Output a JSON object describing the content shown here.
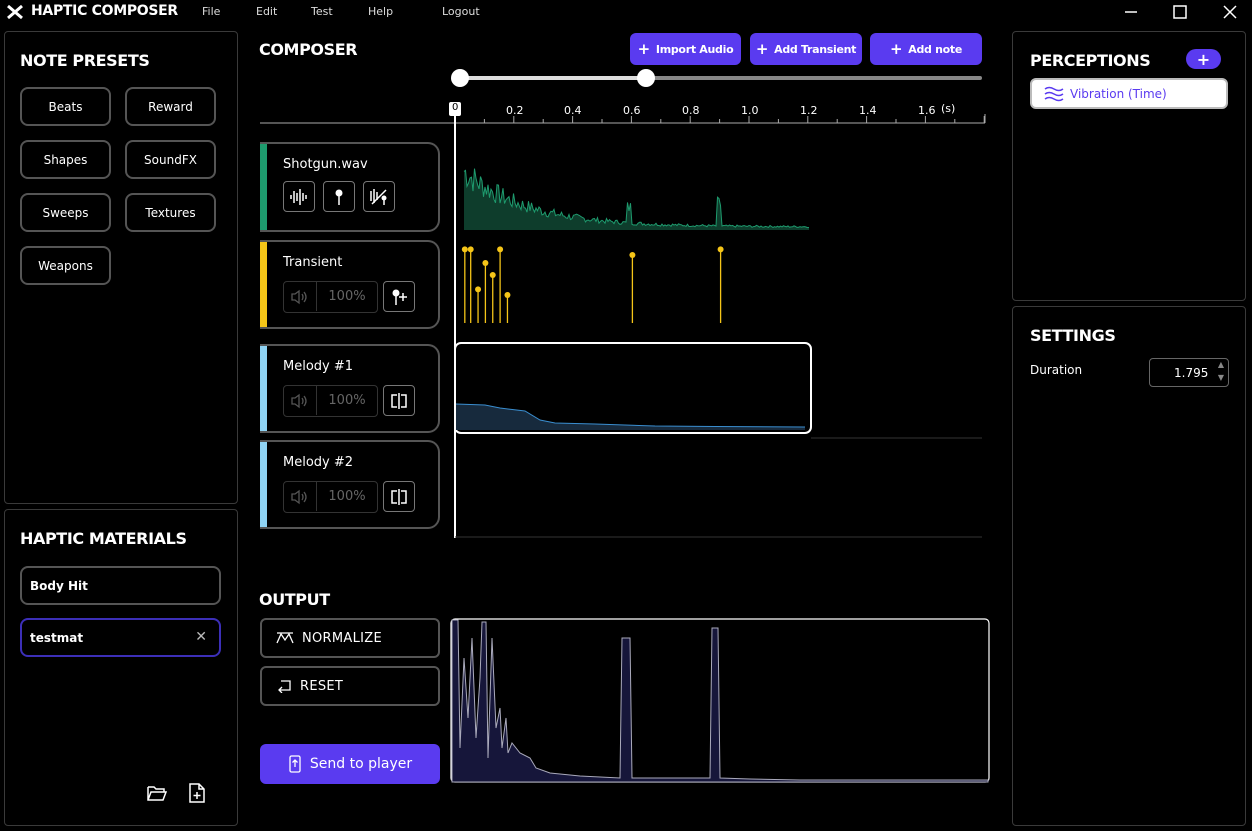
{
  "app": {
    "title": "HAPTIC COMPOSER",
    "menu": [
      "File",
      "Edit",
      "Test",
      "Help",
      "Logout"
    ]
  },
  "note_presets": {
    "title": "NOTE PRESETS",
    "items": [
      "Beats",
      "Reward",
      "Shapes",
      "SoundFX",
      "Sweeps",
      "Textures",
      "Weapons"
    ]
  },
  "haptic_materials": {
    "title": "HAPTIC MATERIALS",
    "items": [
      {
        "label": "Body Hit",
        "selected": false
      },
      {
        "label": "testmat",
        "selected": true
      }
    ]
  },
  "composer": {
    "title": "COMPOSER",
    "buttons": {
      "import_audio": "Import Audio",
      "add_transient": "Add Transient",
      "add_note": "Add note"
    },
    "range_slider": {
      "start": 0.0,
      "end": 0.36
    },
    "timeline": {
      "ticks": [
        "0",
        "0.2",
        "0.4",
        "0.6",
        "0.8",
        "1.0",
        "1.2",
        "1.4",
        "1.6"
      ],
      "unit": "(s)"
    },
    "tracks": [
      {
        "name": "Shotgun.wav",
        "color": "#1e9b6e",
        "type": "audio"
      },
      {
        "name": "Transient",
        "color": "#f5c518",
        "type": "transient",
        "volume": "100%"
      },
      {
        "name": "Melody #1",
        "color": "#8fd3f4",
        "type": "melody",
        "volume": "100%"
      },
      {
        "name": "Melody #2",
        "color": "#8fd3f4",
        "type": "melody",
        "volume": "100%"
      }
    ],
    "transient_events": [
      {
        "t": 0.03,
        "h": 0.92
      },
      {
        "t": 0.05,
        "h": 0.92
      },
      {
        "t": 0.075,
        "h": 0.42
      },
      {
        "t": 0.1,
        "h": 0.75
      },
      {
        "t": 0.125,
        "h": 0.6
      },
      {
        "t": 0.15,
        "h": 0.92
      },
      {
        "t": 0.175,
        "h": 0.35
      },
      {
        "t": 0.6,
        "h": 0.85
      },
      {
        "t": 0.9,
        "h": 0.92
      }
    ]
  },
  "output": {
    "title": "OUTPUT",
    "normalize": "NORMALIZE",
    "reset": "RESET",
    "send": "Send to player"
  },
  "perceptions": {
    "title": "PERCEPTIONS",
    "items": [
      "Vibration (Time)"
    ]
  },
  "settings": {
    "title": "SETTINGS",
    "duration_label": "Duration",
    "duration_value": "1.795"
  },
  "colors": {
    "accent": "#5a3bf0",
    "audio_wave": "#1e9b6e",
    "transient": "#f5c518",
    "melody": "#8fd3f4"
  }
}
